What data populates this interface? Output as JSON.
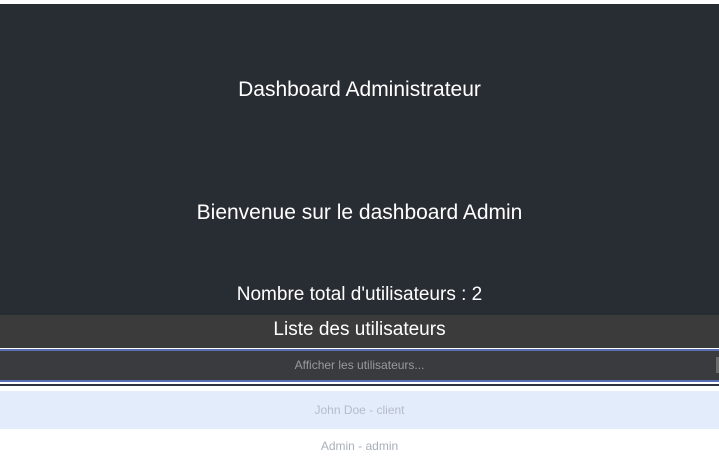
{
  "header": {
    "title": "Dashboard Administrateur"
  },
  "main": {
    "welcome": "Bienvenue sur le dashboard Admin",
    "total_label": "Nombre total d'utilisateurs : 2"
  },
  "users_section": {
    "title": "Liste des utilisateurs",
    "toggle_label": "Afficher les utilisateurs...",
    "items": [
      {
        "label": "John Doe - client"
      },
      {
        "label": "Admin - admin"
      }
    ]
  },
  "colors": {
    "panel_bg": "#282c33",
    "list_header_bg": "#3b3b3b",
    "toggle_border": "#5a6fb3",
    "item_highlight": "#e3ecfb"
  }
}
